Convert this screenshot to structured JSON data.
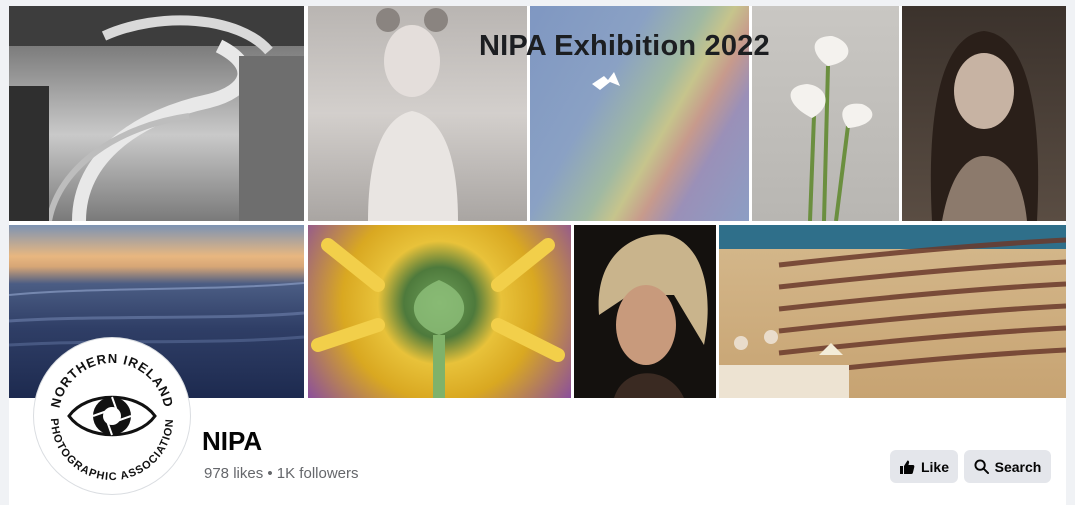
{
  "cover": {
    "title": "NIPA Exhibition 2022",
    "photos": [
      "spiral-staircase-photo",
      "girl-portrait-photo",
      "rainbow-bird-photo",
      "calla-lily-photo",
      "smiling-girl-photo",
      "seascape-sunset-photo",
      "sunflower-photo",
      "headscarf-woman-photo",
      "pharmacy-shelves-photo"
    ]
  },
  "profile": {
    "logo_text_top": "NORTHERN IRELAND",
    "logo_text_bottom": "PHOTOGRAPHIC ASSOCIATION",
    "name": "NIPA",
    "stats": "978 likes • 1K followers"
  },
  "actions": {
    "like_label": "Like",
    "search_label": "Search"
  },
  "colors": {
    "button_bg": "#e4e6eb",
    "text_primary": "#050505",
    "text_secondary": "#65676b"
  }
}
